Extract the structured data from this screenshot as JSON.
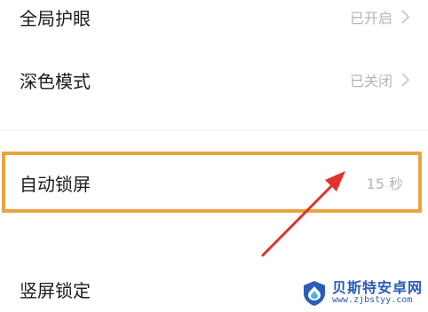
{
  "settings": {
    "rows": [
      {
        "label": "全局护眼",
        "value": "已开启"
      },
      {
        "label": "深色模式",
        "value": "已关闭"
      },
      {
        "label": "自动锁屏",
        "value": "15 秒"
      },
      {
        "label": "竖屏锁定"
      }
    ]
  },
  "watermark": {
    "title": "贝斯特安卓网",
    "url": "www.zjbstyy.com"
  },
  "colors": {
    "highlight": "#e9a440",
    "arrow": "#e0342b",
    "value_text": "#b5b5b5",
    "brand": "#2a5cb8"
  }
}
